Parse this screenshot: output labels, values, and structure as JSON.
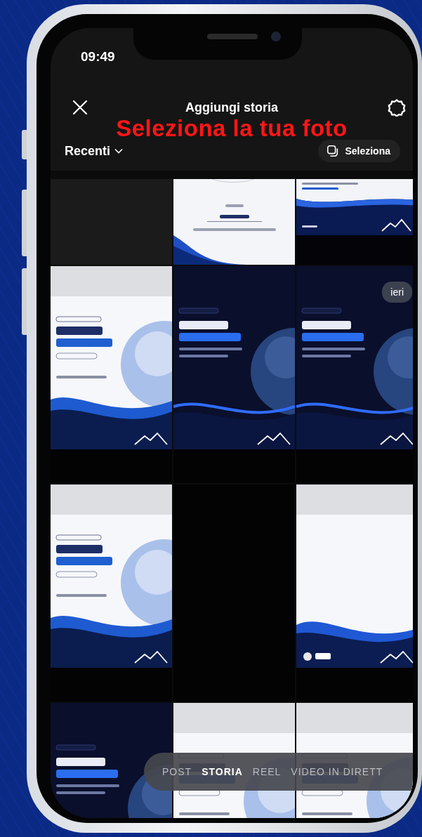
{
  "status_bar": {
    "time": "09:49"
  },
  "header": {
    "title": "Aggiungi storia",
    "overlay_caption": "Seleziona la tua foto",
    "album": "Recenti",
    "select_button": "Seleziona"
  },
  "tiles": [
    {
      "kind": "empty"
    },
    {
      "kind": "picture"
    },
    {
      "kind": "picture"
    },
    {
      "kind": "picture"
    },
    {
      "kind": "picture"
    },
    {
      "kind": "picture",
      "date_label": "ieri"
    },
    {
      "kind": "picture"
    },
    {
      "kind": "empty"
    },
    {
      "kind": "picture"
    },
    {
      "kind": "picture"
    },
    {
      "kind": "picture"
    },
    {
      "kind": "picture"
    }
  ],
  "modes": [
    {
      "label": "POST",
      "selected": false
    },
    {
      "label": "STORIA",
      "selected": true
    },
    {
      "label": "REEL",
      "selected": false
    },
    {
      "label": "VIDEO IN DIRETT",
      "selected": false
    }
  ]
}
